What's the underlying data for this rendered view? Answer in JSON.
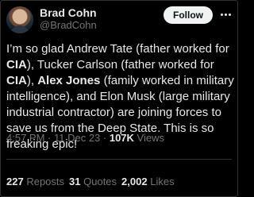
{
  "author": {
    "name": "Brad Cohn",
    "handle": "@BradCohn"
  },
  "follow_label": "Follow",
  "more_icon": "more-horizontal-icon",
  "tweet": {
    "p1": "I’m so glad Andrew Tate (father worked for ",
    "b1": "CIA",
    "p2": "), Tucker Carlson (father worked for ",
    "b2": "CIA",
    "p3": "), ",
    "b3": "Alex Jones",
    "p4": " (family worked in military intelligence),  and Elon Musk (large military industrial contractor) are joining forces to save us from the Deep State.  This is so freaking epic!"
  },
  "meta": {
    "time": "4:57 PM",
    "sep1": " · ",
    "date": "11 Dec 23",
    "sep2": " · ",
    "views_count": "107K",
    "views_label": " Views"
  },
  "stats": {
    "reposts_count": "227",
    "reposts_label": "Reposts",
    "quotes_count": "31",
    "quotes_label": "Quotes",
    "likes_count": "2,002",
    "likes_label": "Likes"
  }
}
